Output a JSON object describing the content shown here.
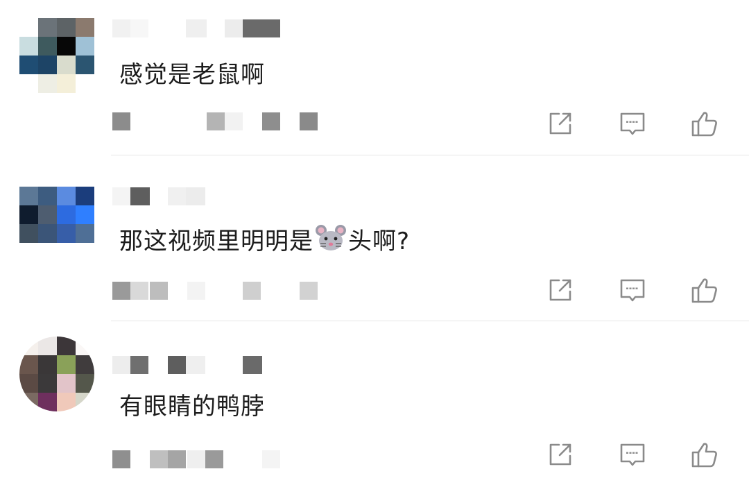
{
  "comments": [
    {
      "text": "感觉是老鼠啊",
      "parts": [
        "感觉是老鼠啊",
        ""
      ]
    },
    {
      "text": "那这视频里明明是🐭头啊?",
      "parts": [
        "那这视频里明明是",
        "头啊?"
      ]
    },
    {
      "text": "有眼睛的鸭脖",
      "parts": [
        "有眼睛的鸭脖",
        ""
      ]
    }
  ],
  "icons": {
    "share": "share-icon",
    "reply": "comment-icon",
    "like": "thumbs-up-icon",
    "emoji": "mouse-face-emoji"
  },
  "colors": {
    "text": "#1c1c1c",
    "icon": "#8a8a8a",
    "divider": "#e6e6e6"
  }
}
